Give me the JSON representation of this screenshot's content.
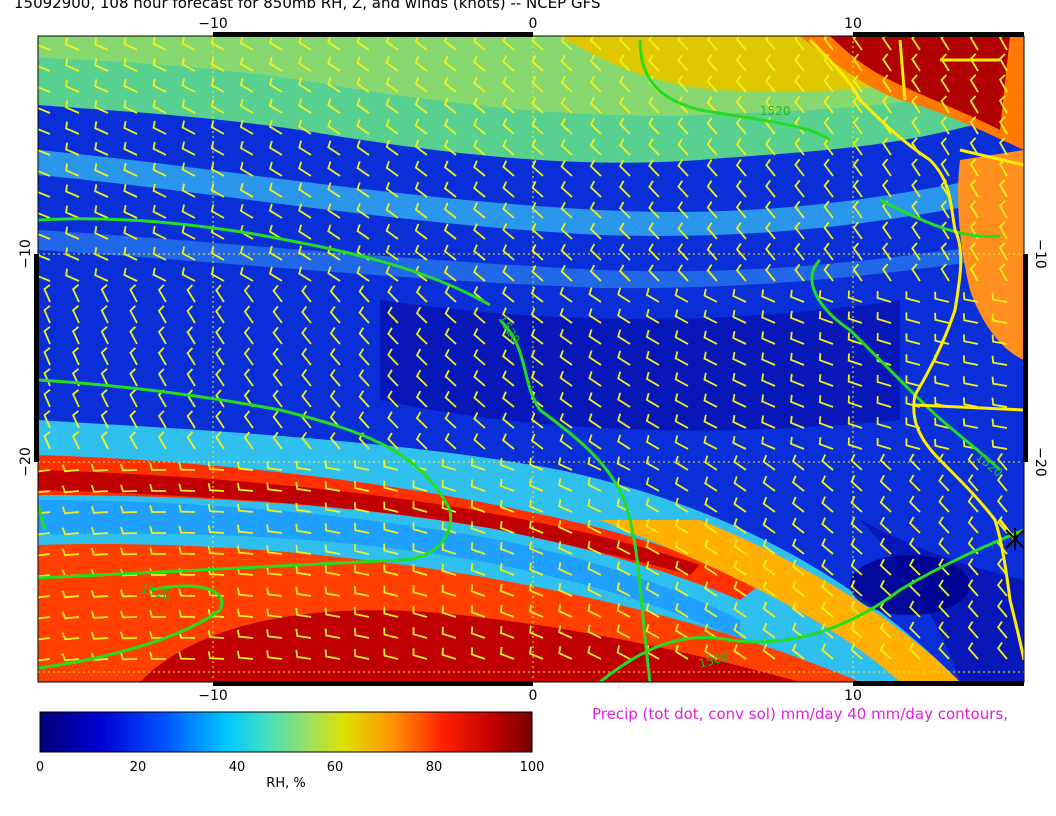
{
  "title": "15092900, 108 hour forecast for 850mb RH, Z, and winds (knots)  -- NCEP GFS",
  "precip_note": "Precip (tot dot, conv sol) mm/day 40 mm/day contours,",
  "axes": {
    "lon_labels": [
      "−10",
      "0",
      "10"
    ],
    "lat_labels": [
      "−10",
      "−20"
    ]
  },
  "contour_labels": [
    "1520",
    "1520",
    "1520",
    "1520",
    "1500"
  ],
  "colorbar": {
    "title": "RH, %",
    "ticks": [
      "0",
      "20",
      "40",
      "60",
      "80",
      "100"
    ],
    "range": [
      0,
      100
    ]
  },
  "colors": {
    "contour": "#22dd22",
    "wind_barbs": "#f0f020",
    "coastline": "#ffee00",
    "precip_text": "#e020e0"
  }
}
